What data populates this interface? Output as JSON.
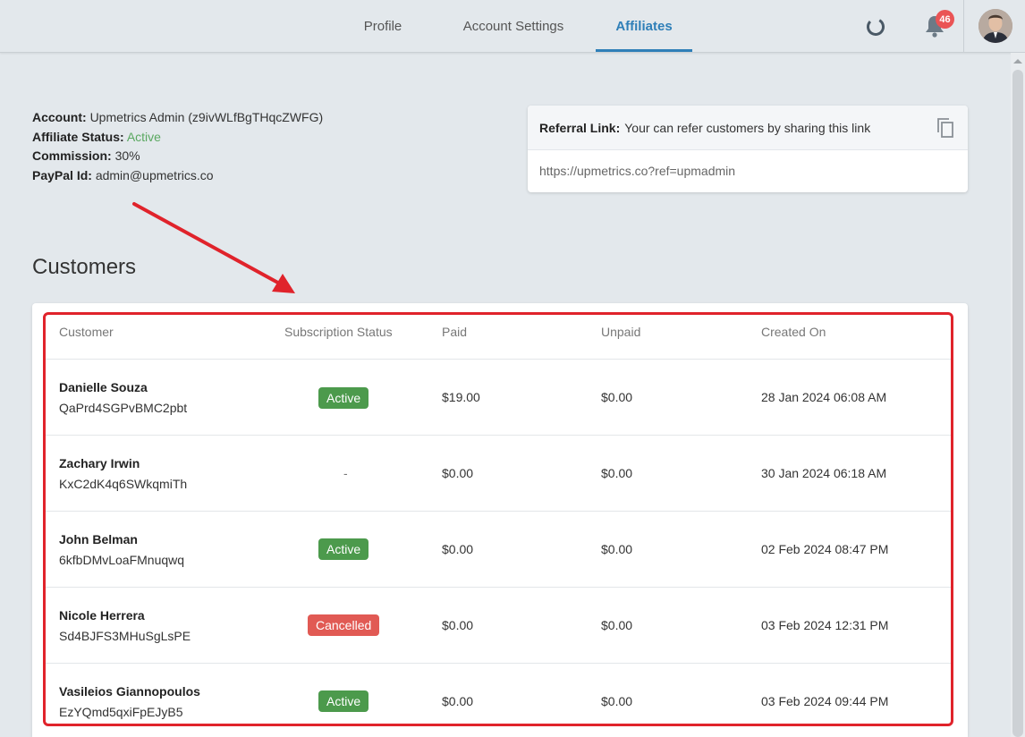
{
  "header": {
    "tabs": [
      {
        "label": "Profile"
      },
      {
        "label": "Account Settings"
      },
      {
        "label": "Affiliates"
      }
    ],
    "active_tab": "Affiliates",
    "notification_count": "46",
    "accent_color": "#2f7fb8"
  },
  "account": {
    "account_label": "Account:",
    "account_value": "Upmetrics Admin (z9ivWLfBgTHqcZWFG)",
    "status_label": "Affiliate Status:",
    "status_value": "Active",
    "commission_label": "Commission:",
    "commission_value": "30%",
    "paypal_label": "PayPal Id:",
    "paypal_value": "admin@upmetrics.co"
  },
  "referral": {
    "label": "Referral Link:",
    "text": "Your can refer customers by sharing this link",
    "url": "https://upmetrics.co?ref=upmadmin",
    "icon": "copy-icon"
  },
  "customers": {
    "title": "Customers",
    "columns": [
      "Customer",
      "Subscription Status",
      "Paid",
      "Unpaid",
      "Created On"
    ],
    "rows": [
      {
        "name": "Danielle Souza",
        "id": "QaPrd4SGPvBMC2pbt",
        "status": "Active",
        "paid": "$19.00",
        "unpaid": "$0.00",
        "created": "28 Jan 2024 06:08 AM"
      },
      {
        "name": "Zachary Irwin",
        "id": "KxC2dK4q6SWkqmiTh",
        "status": "-",
        "paid": "$0.00",
        "unpaid": "$0.00",
        "created": "30 Jan 2024 06:18 AM"
      },
      {
        "name": "John Belman",
        "id": "6kfbDMvLoaFMnuqwq",
        "status": "Active",
        "paid": "$0.00",
        "unpaid": "$0.00",
        "created": "02 Feb 2024 08:47 PM"
      },
      {
        "name": "Nicole Herrera",
        "id": "Sd4BJFS3MHuSgLsPE",
        "status": "Cancelled",
        "paid": "$0.00",
        "unpaid": "$0.00",
        "created": "03 Feb 2024 12:31 PM"
      },
      {
        "name": "Vasileios Giannopoulos",
        "id": "EzYQmd5qxiFpEJyB5",
        "status": "Active",
        "paid": "$0.00",
        "unpaid": "$0.00",
        "created": "03 Feb 2024 09:44 PM"
      }
    ]
  },
  "colors": {
    "active_badge": "#4c9a4c",
    "cancelled_badge": "#e15a54",
    "highlight": "#e0232b"
  }
}
